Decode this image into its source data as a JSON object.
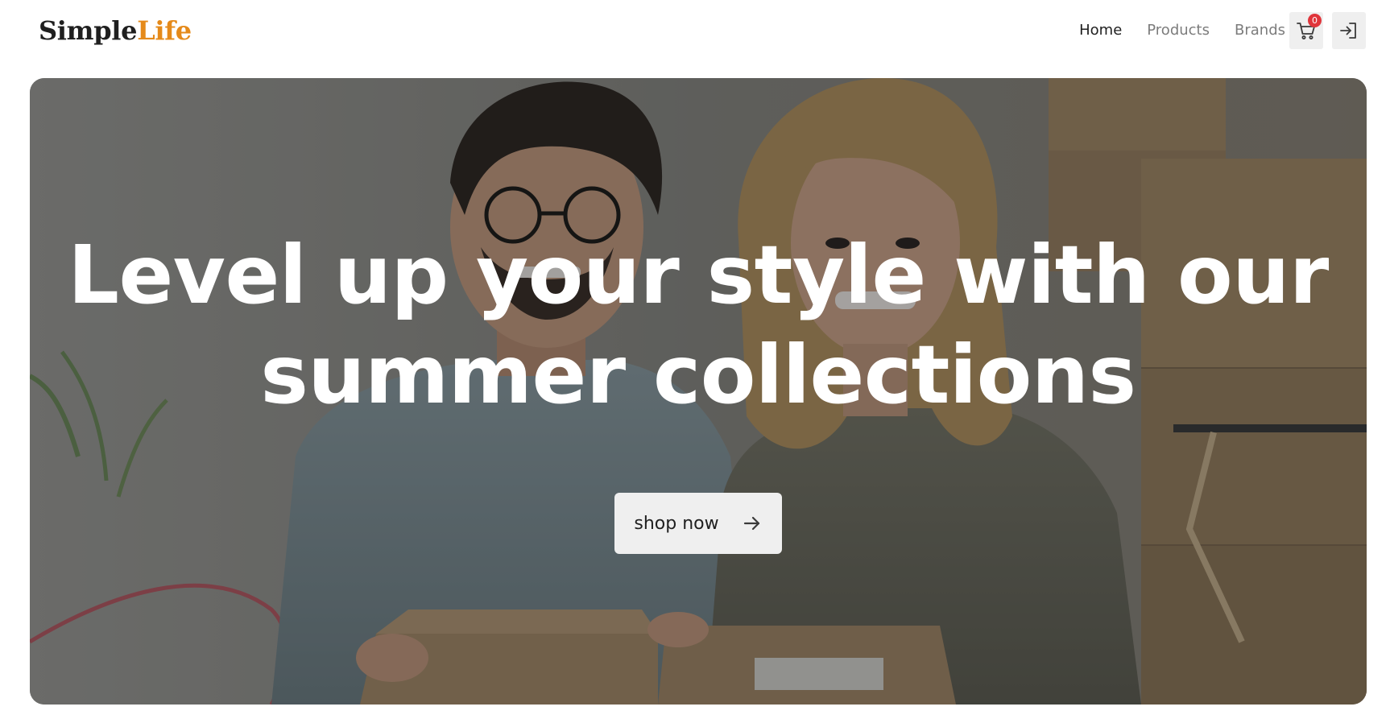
{
  "header": {
    "logo": {
      "part1": "Simple",
      "part2": "Life"
    },
    "nav": [
      {
        "label": "Home",
        "active": true
      },
      {
        "label": "Products",
        "active": false
      },
      {
        "label": "Brands",
        "active": false
      }
    ],
    "cart": {
      "icon": "cart-icon",
      "count": "0"
    },
    "login": {
      "icon": "login-icon"
    }
  },
  "hero": {
    "title_line1": "Level up your style with our",
    "title_line2": "summer collections",
    "cta_label": "shop now",
    "cta_icon": "arrow-right-icon"
  },
  "colors": {
    "accent": "#e58a1a",
    "badge": "#e0353b",
    "text": "#1f1f1f",
    "nav_inactive": "#7c7c7c",
    "button_bg": "#efefef"
  }
}
